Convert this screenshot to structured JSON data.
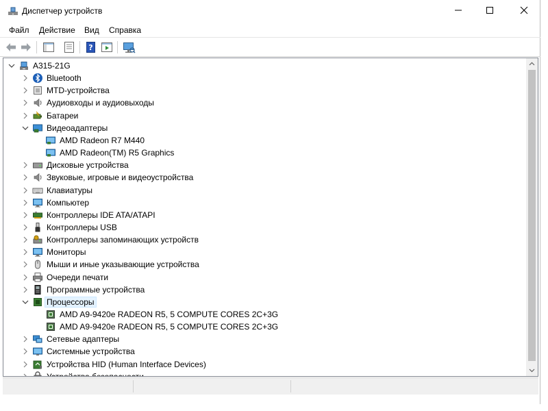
{
  "window": {
    "title": "Диспетчер устройств"
  },
  "menu": {
    "items": [
      "Файл",
      "Действие",
      "Вид",
      "Справка"
    ]
  },
  "toolbar": {
    "buttons": [
      "back-arrow-icon",
      "forward-arrow-icon",
      "show-hide-console-tree-icon",
      "properties-icon",
      "help-icon",
      "run-icon",
      "scan-hardware-icon"
    ]
  },
  "tree": {
    "root": "A315-21G",
    "items": [
      {
        "label": "Bluetooth",
        "icon": "bluetooth-icon",
        "state": "collapsed"
      },
      {
        "label": "MTD-устройства",
        "icon": "mtd-device-icon",
        "state": "collapsed"
      },
      {
        "label": "Аудиовходы и аудиовыходы",
        "icon": "speaker-icon",
        "state": "collapsed"
      },
      {
        "label": "Батареи",
        "icon": "battery-icon",
        "state": "collapsed"
      },
      {
        "label": "Видеоадаптеры",
        "icon": "display-adapter-icon",
        "state": "expanded",
        "children": [
          "AMD Radeon R7 M440",
          "AMD Radeon(TM) R5 Graphics"
        ]
      },
      {
        "label": "Дисковые устройства",
        "icon": "disk-drive-icon",
        "state": "collapsed"
      },
      {
        "label": "Звуковые, игровые и видеоустройства",
        "icon": "speaker-icon",
        "state": "collapsed"
      },
      {
        "label": "Клавиатуры",
        "icon": "keyboard-icon",
        "state": "collapsed"
      },
      {
        "label": "Компьютер",
        "icon": "computer-icon",
        "state": "collapsed"
      },
      {
        "label": "Контроллеры IDE ATA/ATAPI",
        "icon": "ide-controller-icon",
        "state": "collapsed"
      },
      {
        "label": "Контроллеры USB",
        "icon": "usb-icon",
        "state": "collapsed"
      },
      {
        "label": "Контроллеры запоминающих устройств",
        "icon": "storage-controller-icon",
        "state": "collapsed"
      },
      {
        "label": "Мониторы",
        "icon": "monitor-icon",
        "state": "collapsed"
      },
      {
        "label": "Мыши и иные указывающие устройства",
        "icon": "mouse-icon",
        "state": "collapsed"
      },
      {
        "label": "Очереди печати",
        "icon": "printer-icon",
        "state": "collapsed"
      },
      {
        "label": "Программные устройства",
        "icon": "software-device-icon",
        "state": "collapsed"
      },
      {
        "label": "Процессоры",
        "icon": "processor-icon",
        "state": "expanded",
        "selected": true,
        "children": [
          "AMD A9-9420e RADEON R5, 5 COMPUTE CORES 2C+3G",
          "AMD A9-9420e RADEON R5, 5 COMPUTE CORES 2C+3G"
        ]
      },
      {
        "label": "Сетевые адаптеры",
        "icon": "network-adapter-icon",
        "state": "collapsed"
      },
      {
        "label": "Системные устройства",
        "icon": "system-device-icon",
        "state": "collapsed"
      },
      {
        "label": "Устройства HID (Human Interface Devices)",
        "icon": "hid-icon",
        "state": "collapsed"
      },
      {
        "label": "Устройства безопасности",
        "icon": "security-device-icon",
        "state": "collapsed"
      }
    ]
  },
  "colors": {
    "selection_bg": "#e5f3ff",
    "monitor_blue": "#3c8fd6",
    "chip_green": "#3a7d32"
  }
}
